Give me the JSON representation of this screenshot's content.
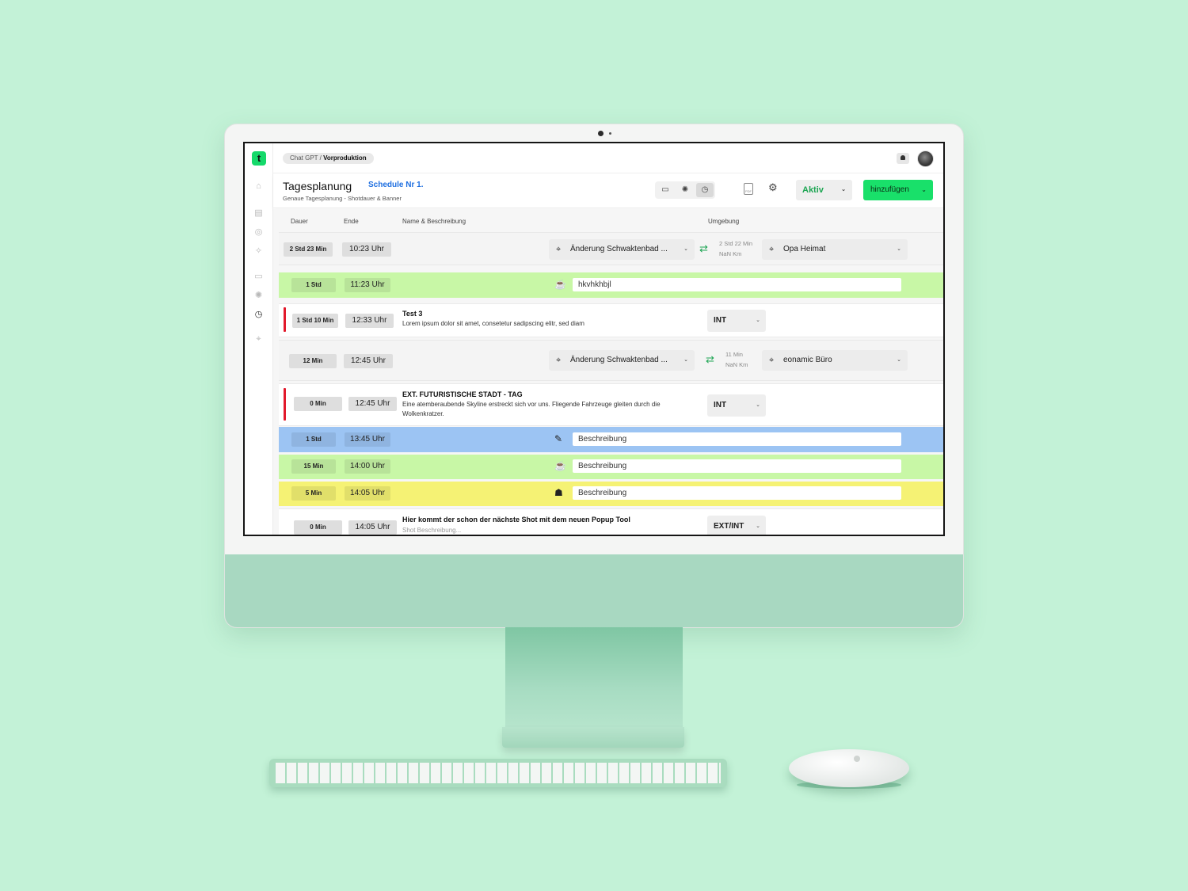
{
  "app": {
    "breadcrumb": {
      "project": "Chat GPT",
      "separator": "/",
      "phase": "Vorproduktion"
    },
    "header": {
      "title": "Tagesplanung",
      "schedule": "Schedule Nr 1.",
      "subtitle": "Genaue Tagesplanung - Shotdauer & Banner",
      "pdf_label": "PDF",
      "status": "Aktiv",
      "add_label": "hinzufügen"
    },
    "columns": {
      "duration": "Dauer",
      "end": "Ende",
      "name": "Name & Beschreibung",
      "environment": "Umgebung"
    },
    "rows": [
      {
        "type": "travel",
        "duration": "2 Std 23 Min",
        "end": "10:23 Uhr",
        "from": "Änderung Schwaktenbad ...",
        "travel_time": "2 Std 22 Min",
        "distance": "NaN Km",
        "to": "Opa Heimat"
      },
      {
        "type": "break",
        "color": "#c8f7a6",
        "icon": "coffee-icon",
        "duration": "1 Std",
        "end": "11:23 Uhr",
        "text": "hkvhkhbjl"
      },
      {
        "type": "scene",
        "duration": "1 Std 10 Min",
        "end": "12:33 Uhr",
        "title": "Test 3",
        "description": "Lorem ipsum dolor sit amet, consetetur sadipscing elitr, sed diam",
        "env": "INT"
      },
      {
        "type": "travel",
        "duration": "12 Min",
        "end": "12:45 Uhr",
        "from": "Änderung Schwaktenbad ...",
        "travel_time": "11 Min",
        "distance": "NaN Km",
        "to": "eonamic Büro"
      },
      {
        "type": "scene",
        "duration": "0 Min",
        "end": "12:45 Uhr",
        "title": "EXT. FUTURISTISCHE STADT - TAG",
        "description": "Eine atemberaubende Skyline erstreckt sich vor uns. Fliegende Fahrzeuge gleiten durch die Wolkenkratzer.",
        "env": "INT"
      },
      {
        "type": "banner",
        "color": "#9cc4f3",
        "icon": "makeup-icon",
        "duration": "1 Std",
        "end": "13:45 Uhr",
        "text": "Beschreibung"
      },
      {
        "type": "break",
        "color": "#c8f7a6",
        "icon": "coffee-icon",
        "duration": "15 Min",
        "end": "14:00 Uhr",
        "text": "Beschreibung"
      },
      {
        "type": "banner",
        "color": "#f5f274",
        "icon": "group-icon",
        "duration": "5 Min",
        "end": "14:05 Uhr",
        "text": "Beschreibung"
      },
      {
        "type": "scene",
        "duration": "0 Min",
        "end": "14:05 Uhr",
        "title": "Hier kommt der schon der nächste Shot mit dem neuen Popup Tool",
        "description": "Shot Beschreibung...",
        "env": "EXT/INT"
      }
    ],
    "sidebar_icons": [
      "home-icon",
      "notes-icon",
      "check-icon",
      "magic-icon",
      "book-icon",
      "aperture-icon",
      "clock-icon",
      "location-icon"
    ],
    "colors": {
      "brand": "#15d96a",
      "accent_blue": "#1f6fe0",
      "status_green": "#1ca552",
      "scene_marker": "#e2192b"
    }
  }
}
